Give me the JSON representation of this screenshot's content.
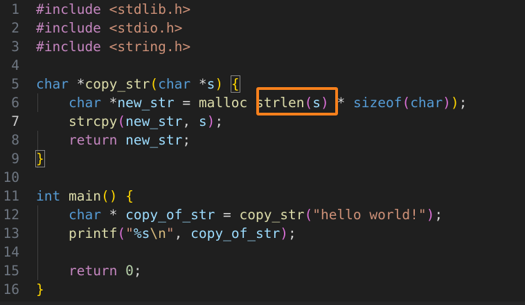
{
  "editor": {
    "highlight_color": "#f7801c",
    "highlighted_text": "strlen(s)",
    "current_line": 7,
    "lines": [
      {
        "number": "1",
        "tokens": [
          {
            "t": "#include ",
            "c": "pre"
          },
          {
            "t": "<stdlib.h>",
            "c": "hdr"
          }
        ]
      },
      {
        "number": "2",
        "tokens": [
          {
            "t": "#include ",
            "c": "pre"
          },
          {
            "t": "<stdio.h>",
            "c": "hdr"
          }
        ]
      },
      {
        "number": "3",
        "tokens": [
          {
            "t": "#include ",
            "c": "pre"
          },
          {
            "t": "<string.h>",
            "c": "hdr"
          }
        ]
      },
      {
        "number": "4",
        "tokens": []
      },
      {
        "number": "5",
        "tokens": [
          {
            "t": "char",
            "c": "kw"
          },
          {
            "t": " *",
            "c": "op"
          },
          {
            "t": "copy_str",
            "c": "fn"
          },
          {
            "t": "(",
            "c": "p1"
          },
          {
            "t": "char",
            "c": "kw"
          },
          {
            "t": " *",
            "c": "op"
          },
          {
            "t": "s",
            "c": "var"
          },
          {
            "t": ")",
            "c": "p1"
          },
          {
            "t": " ",
            "c": "op"
          },
          {
            "t": "{",
            "c": "p1",
            "m": true
          }
        ]
      },
      {
        "number": "6",
        "tokens": [
          {
            "t": "    ",
            "c": "op"
          },
          {
            "t": "char",
            "c": "kw"
          },
          {
            "t": " *",
            "c": "op"
          },
          {
            "t": "new_str",
            "c": "var"
          },
          {
            "t": " = ",
            "c": "op"
          },
          {
            "t": "malloc",
            "c": "fn"
          },
          {
            "t": " ",
            "c": "op"
          },
          {
            "t": "strlen",
            "c": "fn"
          },
          {
            "t": "(",
            "c": "p2"
          },
          {
            "t": "s",
            "c": "var"
          },
          {
            "t": ")",
            "c": "p2"
          },
          {
            "t": " * ",
            "c": "op"
          },
          {
            "t": "sizeof",
            "c": "kw"
          },
          {
            "t": "(",
            "c": "p2"
          },
          {
            "t": "char",
            "c": "kw"
          },
          {
            "t": ")",
            "c": "p2"
          },
          {
            "t": ")",
            "c": "p1"
          },
          {
            "t": ";",
            "c": "op"
          }
        ]
      },
      {
        "number": "7",
        "tokens": [
          {
            "t": "    ",
            "c": "op"
          },
          {
            "t": "strcpy",
            "c": "fn"
          },
          {
            "t": "(",
            "c": "p2"
          },
          {
            "t": "new_str",
            "c": "var"
          },
          {
            "t": ", ",
            "c": "op"
          },
          {
            "t": "s",
            "c": "var"
          },
          {
            "t": ")",
            "c": "p2"
          },
          {
            "t": ";",
            "c": "op"
          }
        ]
      },
      {
        "number": "8",
        "tokens": [
          {
            "t": "    ",
            "c": "op"
          },
          {
            "t": "return",
            "c": "ctl"
          },
          {
            "t": " ",
            "c": "op"
          },
          {
            "t": "new_str",
            "c": "var"
          },
          {
            "t": ";",
            "c": "op"
          }
        ]
      },
      {
        "number": "9",
        "tokens": [
          {
            "t": "}",
            "c": "p1",
            "m": true
          }
        ]
      },
      {
        "number": "10",
        "tokens": []
      },
      {
        "number": "11",
        "tokens": [
          {
            "t": "int",
            "c": "kw"
          },
          {
            "t": " ",
            "c": "op"
          },
          {
            "t": "main",
            "c": "fn"
          },
          {
            "t": "()",
            "c": "p1"
          },
          {
            "t": " ",
            "c": "op"
          },
          {
            "t": "{",
            "c": "p1"
          }
        ]
      },
      {
        "number": "12",
        "tokens": [
          {
            "t": "    ",
            "c": "op"
          },
          {
            "t": "char",
            "c": "kw"
          },
          {
            "t": " * ",
            "c": "op"
          },
          {
            "t": "copy_of_str",
            "c": "var"
          },
          {
            "t": " = ",
            "c": "op"
          },
          {
            "t": "copy_str",
            "c": "fn"
          },
          {
            "t": "(",
            "c": "p2"
          },
          {
            "t": "\"hello world!\"",
            "c": "str"
          },
          {
            "t": ")",
            "c": "p2"
          },
          {
            "t": ";",
            "c": "op"
          }
        ]
      },
      {
        "number": "13",
        "tokens": [
          {
            "t": "    ",
            "c": "op"
          },
          {
            "t": "printf",
            "c": "fn"
          },
          {
            "t": "(",
            "c": "p2"
          },
          {
            "t": "\"",
            "c": "str"
          },
          {
            "t": "%s",
            "c": "var"
          },
          {
            "t": "\\n",
            "c": "esc"
          },
          {
            "t": "\"",
            "c": "str"
          },
          {
            "t": ", ",
            "c": "op"
          },
          {
            "t": "copy_of_str",
            "c": "var"
          },
          {
            "t": ")",
            "c": "p2"
          },
          {
            "t": ";",
            "c": "op"
          }
        ]
      },
      {
        "number": "14",
        "tokens": []
      },
      {
        "number": "15",
        "tokens": [
          {
            "t": "    ",
            "c": "op"
          },
          {
            "t": "return",
            "c": "ctl"
          },
          {
            "t": " ",
            "c": "op"
          },
          {
            "t": "0",
            "c": "num"
          },
          {
            "t": ";",
            "c": "op"
          }
        ]
      },
      {
        "number": "16",
        "tokens": [
          {
            "t": "}",
            "c": "p1"
          }
        ]
      }
    ]
  }
}
